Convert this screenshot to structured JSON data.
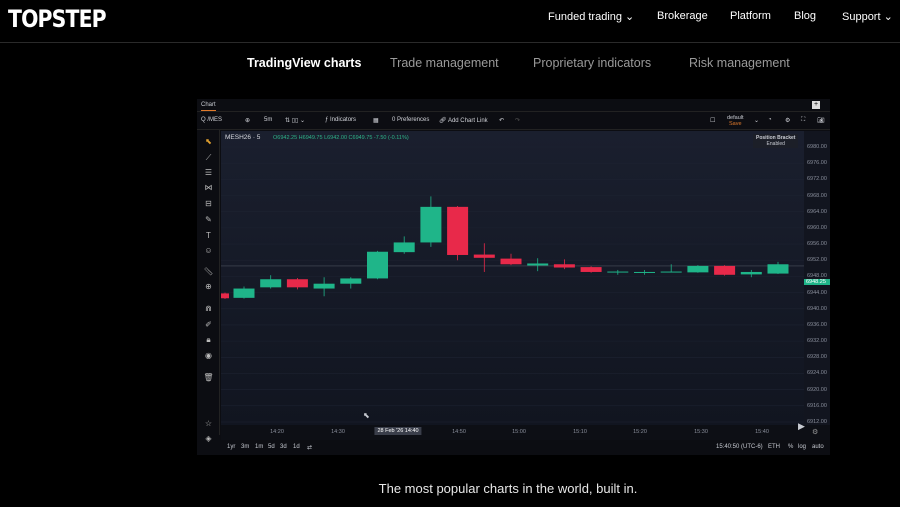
{
  "header": {
    "logo": "TOPSTEP",
    "nav": [
      {
        "label": "Funded trading ⌄"
      },
      {
        "label": "Brokerage"
      },
      {
        "label": "Platform"
      },
      {
        "label": "Blog"
      },
      {
        "label": "Support ⌄"
      }
    ]
  },
  "feature_tabs": [
    {
      "label": "TradingView charts",
      "active": true
    },
    {
      "label": "Trade management"
    },
    {
      "label": "Proprietary indicators"
    },
    {
      "label": "Risk management"
    }
  ],
  "chart_widget": {
    "tab": "Chart",
    "toolbar": {
      "symbol": "Q /MES",
      "interval": "5m",
      "indicators": "Indicators",
      "preferences": "0 Preferences",
      "add_chart_link": "Add Chart Link",
      "layout": "default",
      "layout_status": "Save"
    },
    "legend": {
      "symbol": "MESH26 · 5",
      "ohlc": "O6942.25 H6949.75 L6942.00 C6949.75 -7.50 (-0.11%)"
    },
    "position_badge": {
      "title": "Position Bracket",
      "status": "Enabled"
    },
    "bottom": {
      "ranges": [
        "1yr",
        "3m",
        "1m",
        "5d",
        "3d",
        "1d"
      ],
      "clock": "15:40:50 (UTC-6)",
      "session": "ETH",
      "pct": "%",
      "log": "log",
      "auto": "auto"
    }
  },
  "chart_data": {
    "type": "candlestick",
    "ylim": [
      6912,
      6980
    ],
    "y_ticks": [
      "6980.00",
      "6976.00",
      "6972.00",
      "6968.00",
      "6964.00",
      "6960.00",
      "6956.00",
      "6952.00",
      "6948.00",
      "6944.00",
      "6940.00",
      "6936.00",
      "6932.00",
      "6928.00",
      "6924.00",
      "6920.00",
      "6916.00",
      "6912.00"
    ],
    "x_ticks": [
      "14:20",
      "14:30",
      "28 Feb '26  14:40",
      "14:50",
      "15:00",
      "15:10",
      "15:20",
      "15:30",
      "15:40"
    ],
    "last_price": "6948.25",
    "colors": {
      "up": "#1fb589",
      "down": "#e8294a"
    },
    "candles": [
      {
        "o": 6943.8,
        "h": 6944.0,
        "l": 6942.4,
        "c": 6942.6
      },
      {
        "o": 6942.7,
        "h": 6945.5,
        "l": 6942.5,
        "c": 6945.0
      },
      {
        "o": 6945.3,
        "h": 6948.3,
        "l": 6945.0,
        "c": 6947.3
      },
      {
        "o": 6947.3,
        "h": 6947.6,
        "l": 6944.8,
        "c": 6945.3
      },
      {
        "o": 6945.0,
        "h": 6947.8,
        "l": 6943.1,
        "c": 6946.2
      },
      {
        "o": 6946.2,
        "h": 6947.8,
        "l": 6945.0,
        "c": 6947.5
      },
      {
        "o": 6947.5,
        "h": 6954.3,
        "l": 6947.3,
        "c": 6954.1
      },
      {
        "o": 6954.0,
        "h": 6957.9,
        "l": 6953.6,
        "c": 6956.4
      },
      {
        "o": 6956.4,
        "h": 6967.8,
        "l": 6955.3,
        "c": 6965.2
      },
      {
        "o": 6965.2,
        "h": 6965.4,
        "l": 6952.0,
        "c": 6953.3
      },
      {
        "o": 6953.4,
        "h": 6956.2,
        "l": 6949.1,
        "c": 6952.6
      },
      {
        "o": 6952.4,
        "h": 6953.6,
        "l": 6950.8,
        "c": 6951.0
      },
      {
        "o": 6950.7,
        "h": 6952.5,
        "l": 6949.3,
        "c": 6951.2
      },
      {
        "o": 6951.0,
        "h": 6952.2,
        "l": 6949.8,
        "c": 6950.2
      },
      {
        "o": 6950.3,
        "h": 6950.5,
        "l": 6948.9,
        "c": 6949.1
      },
      {
        "o": 6949.2,
        "h": 6949.6,
        "l": 6948.4,
        "c": 6949.2
      },
      {
        "o": 6949.1,
        "h": 6949.6,
        "l": 6948.4,
        "c": 6949.1
      },
      {
        "o": 6949.2,
        "h": 6951.0,
        "l": 6949.1,
        "c": 6949.2
      },
      {
        "o": 6949.0,
        "h": 6950.8,
        "l": 6948.9,
        "c": 6950.6
      },
      {
        "o": 6950.6,
        "h": 6950.8,
        "l": 6948.2,
        "c": 6948.4
      },
      {
        "o": 6948.5,
        "h": 6949.6,
        "l": 6947.8,
        "c": 6949.1
      },
      {
        "o": 6948.7,
        "h": 6951.6,
        "l": 6948.6,
        "c": 6951.0
      }
    ]
  },
  "caption": "The most popular charts in the world, built in."
}
